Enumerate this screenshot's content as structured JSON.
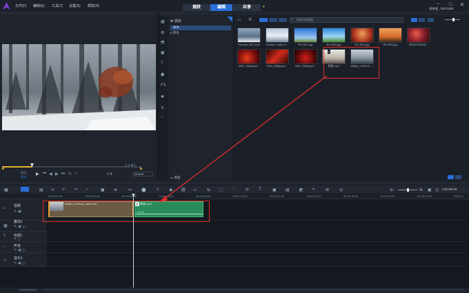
{
  "menu": [
    "文件(F)",
    "编辑(E)",
    "工具(T)",
    "设置(S)",
    "帮助(H)"
  ],
  "modes": [
    "捕获",
    "编辑",
    "共享"
  ],
  "project_info": "未命名, 720*1280",
  "preview": {
    "label_project": "项目-",
    "label_clip": "素材-",
    "timecode": "00:00:0",
    "extra": "V A"
  },
  "library": {
    "add_label": "添加",
    "folders": [
      "样本",
      "转场"
    ],
    "search_placeholder": "搜索当前视图",
    "browse_label": "浏览",
    "thumbs": [
      {
        "label": "Sample_360.mp4",
        "bg": "linear-gradient(#8fa7bf,#5b7086 60%,#e9edf2)"
      },
      {
        "label": "Sample_Lake.m...",
        "bg": "linear-gradient(#b7c6d6,#e6eef5 55%,#7a8a9a)"
      },
      {
        "label": "BG-B01.jpg",
        "bg": "linear-gradient(#2b74d8,#9dc4ef 70%,#6c8f3a)"
      },
      {
        "label": "BG-B02.jpg",
        "bg": "linear-gradient(#2f87df,#9ed4f5 60%,#4c8d2c)"
      },
      {
        "label": "BG-B04.jpg",
        "bg": "radial-gradient(circle at 50% 40%,#eaa35b,#b0341f 60%,#3a140e)"
      },
      {
        "label": "BG-B05.jpg",
        "bg": "linear-gradient(#f0a35c,#d86a2a 60%,#3a2a1c)"
      },
      {
        "label": "MB00003hpt2...",
        "bg": "radial-gradient(circle at 40% 40%,#e85a4a,#8b1f2a 50%,#2a0a10)"
      },
      {
        "label": "Nitro_Wallpape...",
        "bg": "radial-gradient(circle at 40% 60%,#e83a1a,#7b0f0f 55%,#1a0505)"
      },
      {
        "label": "Nitro_Wallpape...",
        "bg": "linear-gradient(135deg,#2a0808,#d22a1a 50%,#300a0a)"
      },
      {
        "label": "Nitro_Wallpape...",
        "bg": "radial-gradient(circle at 50% 60%,#d0201a,#5b0a0a 60%,#140303)"
      },
      {
        "label": "倒放.mp4",
        "bg": "linear-gradient(#e9e7e2,#bdb6ab 60%,#5e564c)"
      },
      {
        "label": "698pic_026hub_...",
        "bg": "linear-gradient(#c9d0d6,#8996a2 60%,#3c4650)"
      }
    ]
  },
  "timeline": {
    "ruler": [
      "00:00:00:00",
      "00:00:02:00",
      "00:00:04:00",
      "00:00:06:00",
      "00:00:08:00",
      "00:00:10:00",
      "00:00:12:00",
      "00:00:14:00",
      "00:00:16:00",
      "00:00:18:00",
      "00:00:20:00",
      "00:00:2"
    ],
    "timecode": "0:00:08:19",
    "tracks": [
      "视频",
      "叠加1",
      "标题1",
      "声音",
      "音乐1"
    ],
    "clip1": "698pic_026hub_spay.mov",
    "clip2": "倒放.mp4",
    "zoom_label": "−"
  },
  "colors": {
    "accent": "#2a6fd6",
    "highlight": "#e0302a",
    "clip_green": "#2a8a5a",
    "clip_brown": "#6b5a44"
  }
}
